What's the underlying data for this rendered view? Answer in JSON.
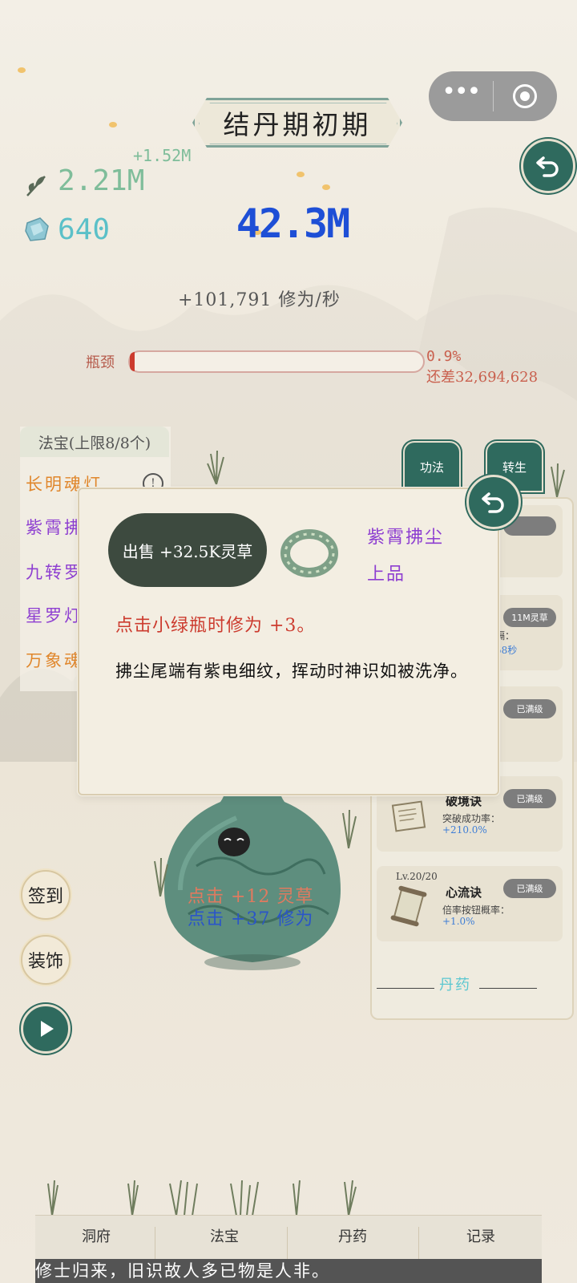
{
  "realm_title": "结丹期初期",
  "resources": {
    "herb_gain": "+1.52M",
    "herb_amount": "2.21M",
    "stone_amount": "640"
  },
  "cultivation": {
    "total": "42.3M",
    "rate": "+101,791 修为/秒"
  },
  "bottleneck": {
    "label": "瓶颈",
    "percent_text": "0.9%",
    "progress": 0.009,
    "remaining": "还差32,694,628"
  },
  "artifacts": {
    "header": "法宝(上限8/8个)",
    "items": [
      {
        "name": "长明魂灯",
        "color": "#e0862b"
      },
      {
        "name": "紫霄拂",
        "color": "#8e3fd1"
      },
      {
        "name": "九转罗",
        "color": "#8e3fd1"
      },
      {
        "name": "星罗灯",
        "color": "#8e3fd1"
      },
      {
        "name": "万象魂",
        "color": "#e0862b"
      }
    ]
  },
  "tabs": {
    "gongfa": "功法",
    "rebirth": "转生"
  },
  "skills": [
    {
      "level": "",
      "name": "",
      "desc": "",
      "value": "",
      "badge": ""
    },
    {
      "level": "",
      "name": "",
      "desc": "隔：",
      "value": "58秒",
      "badge": "11M灵草"
    },
    {
      "level": "",
      "name": "",
      "desc": "",
      "value": "",
      "badge": "已满级"
    },
    {
      "level": "",
      "name": "破境诀",
      "desc": "突破成功率：",
      "value": "+210.0%",
      "badge": "已满级"
    },
    {
      "level": "Lv.20/20",
      "name": "心流诀",
      "desc": "倍率按钮概率：",
      "value": "+1.0%",
      "badge": "已满级"
    }
  ],
  "pill_section_label": "丹药",
  "popup": {
    "sell_label": "出售 +32.5K灵草",
    "item_name": "紫霄拂尘",
    "item_grade": "上品",
    "effect": "点击小绿瓶时修为 +3。",
    "description": "拂尘尾端有紫电细纹，挥动时神识如被洗净。"
  },
  "click_info": {
    "herb": "点击 +12 灵草",
    "cultivation": "点击 +37 修为"
  },
  "side_buttons": {
    "checkin": "签到",
    "decorate": "装饰"
  },
  "nav": [
    "洞府",
    "法宝",
    "丹药",
    "记录"
  ],
  "ticker": "修士归来，旧识故人多已物是人非。",
  "colors": {
    "accent_green": "#2f6a5e",
    "cultivation_blue": "#1e4fd6",
    "herb_green": "#7fbd9a",
    "purple": "#8e3fd1",
    "orange": "#e0862b",
    "red": "#cc3b2e"
  }
}
